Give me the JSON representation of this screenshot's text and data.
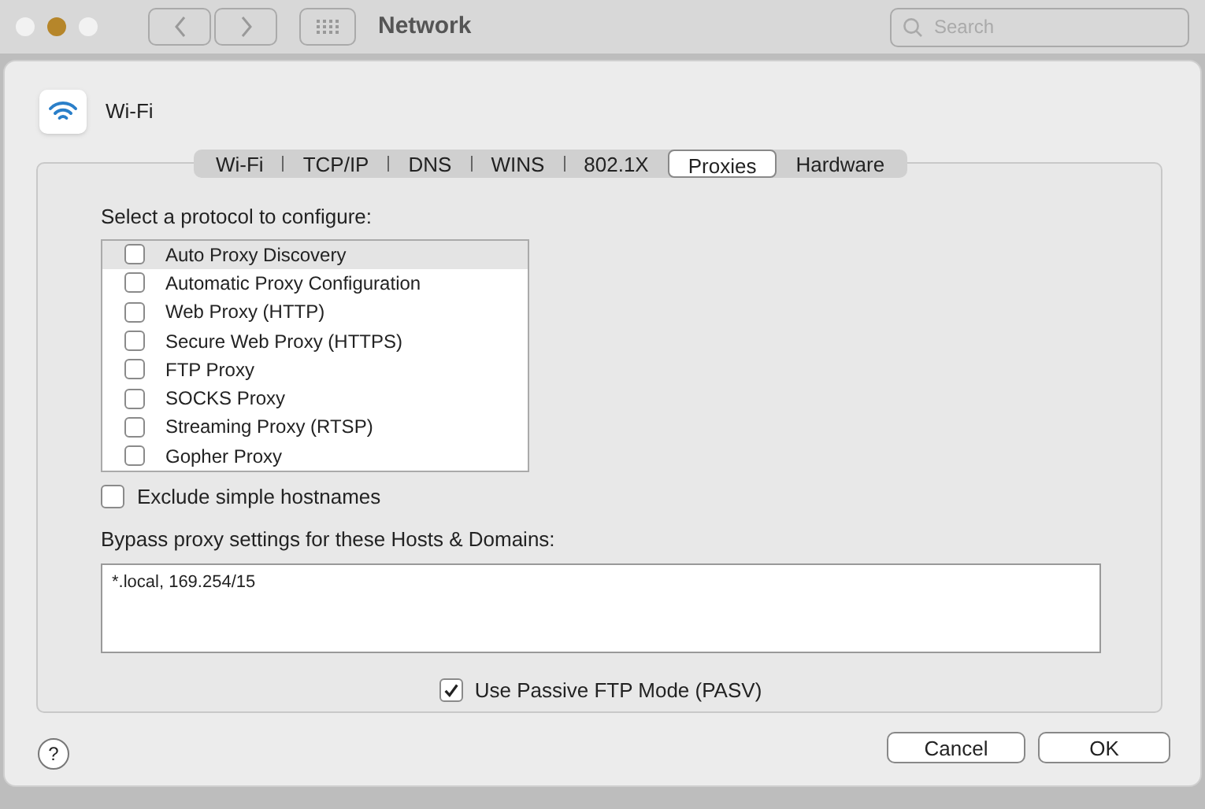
{
  "toolbar": {
    "title": "Network",
    "search": {
      "placeholder": "Search"
    }
  },
  "header": {
    "title": "Wi-Fi"
  },
  "tabs": [
    {
      "label": "Wi-Fi",
      "selected": false
    },
    {
      "label": "TCP/IP",
      "selected": false
    },
    {
      "label": "DNS",
      "selected": false
    },
    {
      "label": "WINS",
      "selected": false
    },
    {
      "label": "802.1X",
      "selected": false
    },
    {
      "label": "Proxies",
      "selected": true
    },
    {
      "label": "Hardware",
      "selected": false
    }
  ],
  "protocols": {
    "label": "Select a protocol to configure:",
    "items": [
      {
        "label": "Auto Proxy Discovery",
        "checked": false,
        "selected": true
      },
      {
        "label": "Automatic Proxy Configuration",
        "checked": false,
        "selected": false
      },
      {
        "label": "Web Proxy (HTTP)",
        "checked": false,
        "selected": false
      },
      {
        "label": "Secure Web Proxy (HTTPS)",
        "checked": false,
        "selected": false
      },
      {
        "label": "FTP Proxy",
        "checked": false,
        "selected": false
      },
      {
        "label": "SOCKS Proxy",
        "checked": false,
        "selected": false
      },
      {
        "label": "Streaming Proxy (RTSP)",
        "checked": false,
        "selected": false
      },
      {
        "label": "Gopher Proxy",
        "checked": false,
        "selected": false
      }
    ]
  },
  "exclude_simple_hostnames": {
    "label": "Exclude simple hostnames",
    "checked": false
  },
  "bypass": {
    "label": "Bypass proxy settings for these Hosts & Domains:",
    "value": "*.local, 169.254/15"
  },
  "passive_ftp": {
    "label": "Use Passive FTP Mode (PASV)",
    "checked": true
  },
  "help": "?",
  "buttons": [
    "Cancel",
    "OK"
  ]
}
